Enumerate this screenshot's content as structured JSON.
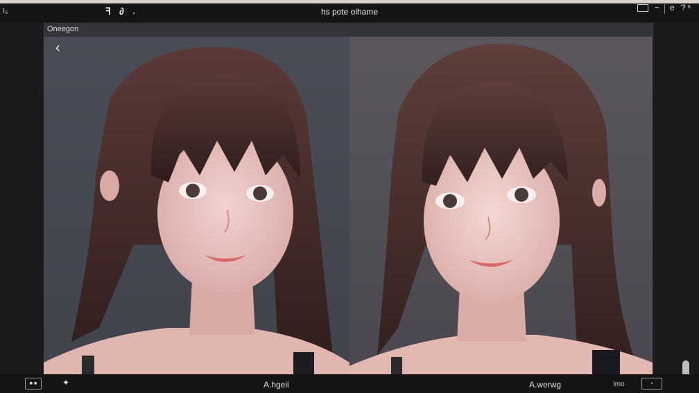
{
  "titlebar": {
    "left_text": "I₅",
    "glyphs": "ꟻ ∂ ˒",
    "title": "hs pote olhame",
    "right_mid": "~",
    "right_text": "e ?ˢ"
  },
  "panel": {
    "title": "Oneegon"
  },
  "bottombar": {
    "left_button": "■ ■",
    "star": "✦",
    "label_left": "A.hgeii",
    "label_right": "A.werwg",
    "small_text": "Imo",
    "right_button": "▪"
  },
  "colors": {
    "chrome": "#141416",
    "panel_header": "#34353a",
    "accent_strip": "#d9d4ca"
  },
  "icons": [
    "screen-icon",
    "back-chevron-icon",
    "sparkle-icon"
  ]
}
